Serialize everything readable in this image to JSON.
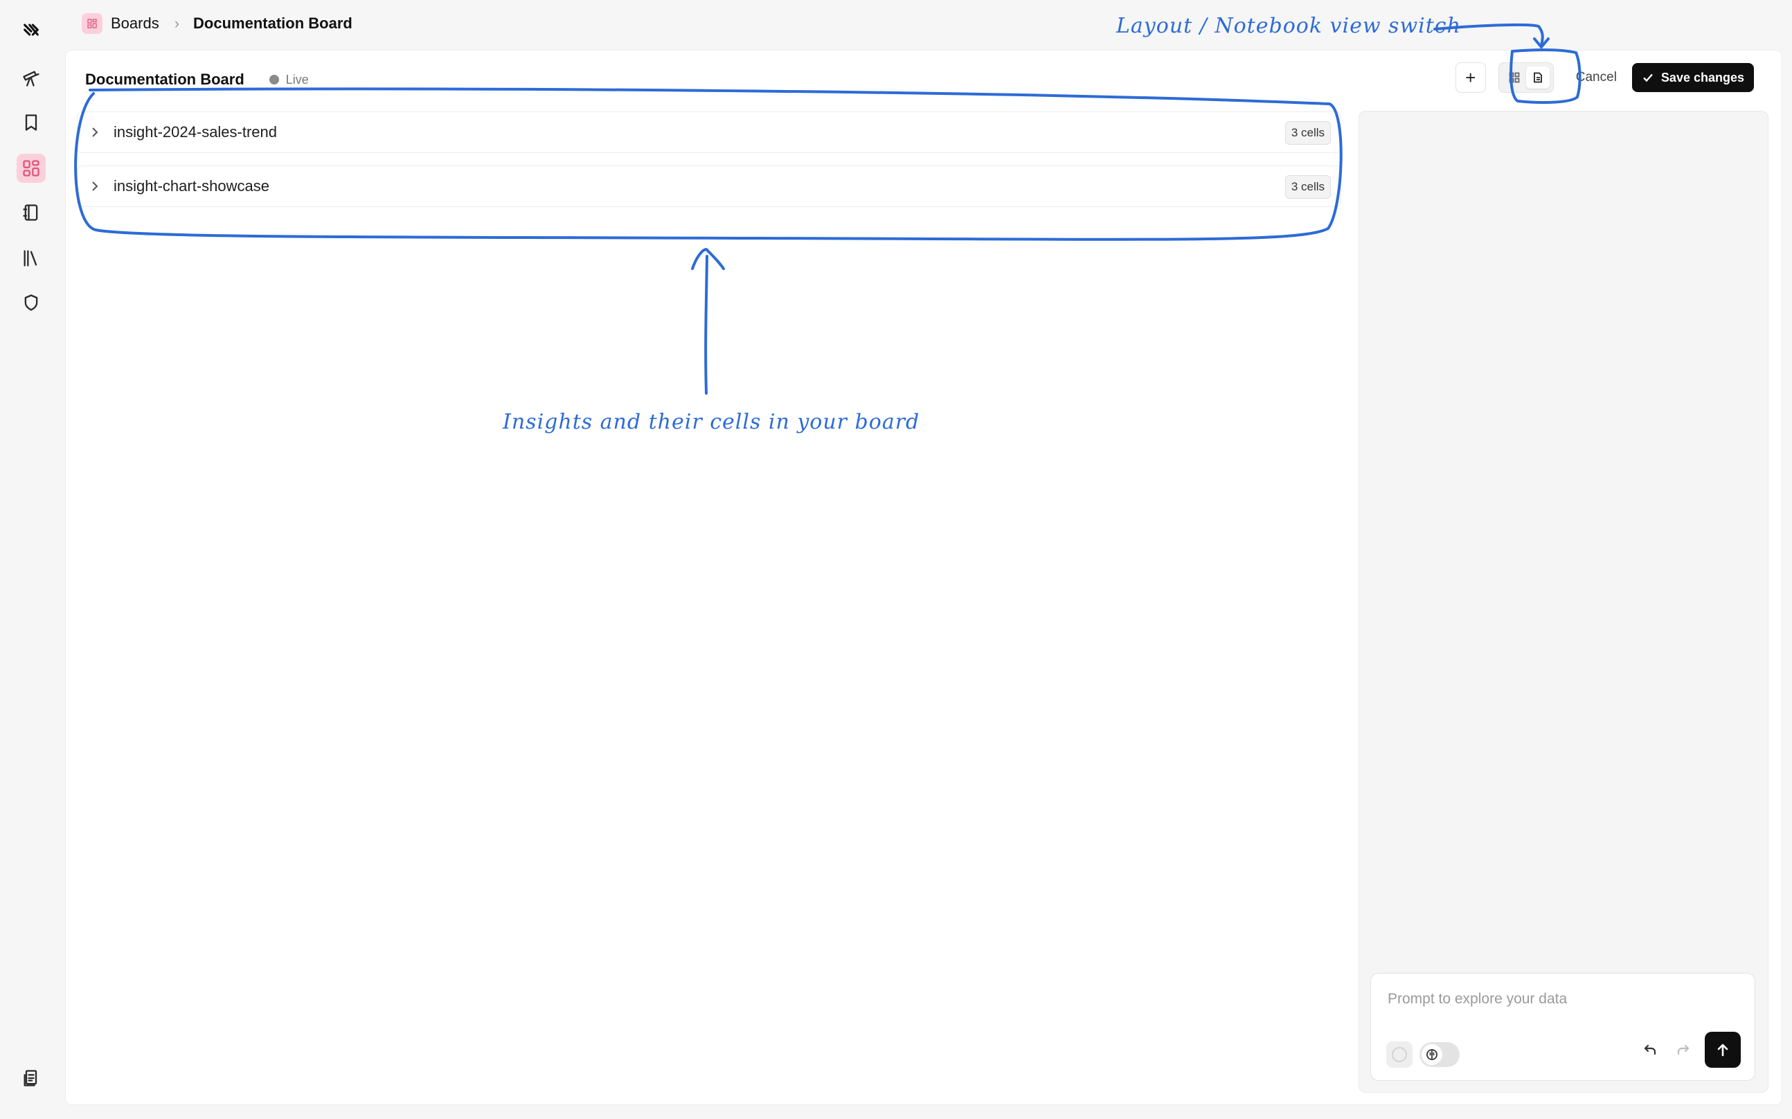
{
  "breadcrumb": {
    "parent": "Boards",
    "current": "Documentation Board"
  },
  "board": {
    "title": "Documentation Board",
    "status": "Live"
  },
  "toolbar": {
    "add_label": "+",
    "cancel_label": "Cancel",
    "save_label": "Save changes"
  },
  "insights": [
    {
      "name": "insight-2024-sales-trend",
      "cells": "3 cells"
    },
    {
      "name": "insight-chart-showcase",
      "cells": "3 cells"
    }
  ],
  "prompt": {
    "placeholder": "Prompt to explore your data"
  },
  "annotations": {
    "view_switch": "Layout / Notebook view switch",
    "insights": "Insights and their cells in your board"
  },
  "colors": {
    "accent": "#e0567d",
    "accent_bg": "#fbd0dc",
    "annotation": "#2d6bd6",
    "primary_button": "#0f0f0f"
  },
  "rail_icons": [
    "logo-icon",
    "telescope-icon",
    "bookmark-icon",
    "boards-icon",
    "notebook-icon",
    "library-icon",
    "shield-icon",
    "docs-icon"
  ]
}
